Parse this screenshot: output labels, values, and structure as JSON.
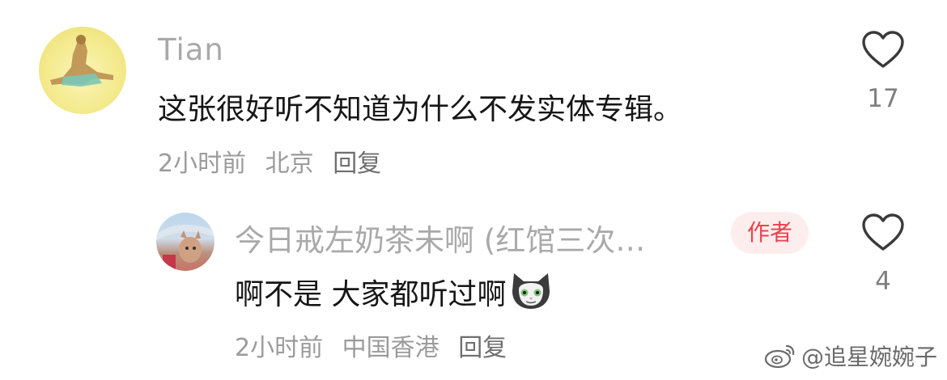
{
  "comments": [
    {
      "username": "Tian",
      "text": "这张很好听不知道为什么不发实体专辑。",
      "time": "2小时前",
      "location": "北京",
      "reply_label": "回复",
      "like_count": "17"
    }
  ],
  "reply": {
    "username": "今日戒左奶茶未啊 (红馆三次…",
    "badge": "作者",
    "text": "啊不是 大家都听过啊",
    "time": "2小时前",
    "location": "中国香港",
    "reply_label": "回复",
    "like_count": "4"
  },
  "watermark": "@追星婉婉子",
  "colors": {
    "username": "#a9a9a9",
    "author_badge_text": "#ef3f4f",
    "author_badge_bg": "#fdeeed",
    "meta": "#9b9b9b"
  },
  "icons": {
    "like": "heart-outline-icon",
    "sticker": "cat-emoji-icon",
    "watermark_logo": "weibo-icon"
  }
}
